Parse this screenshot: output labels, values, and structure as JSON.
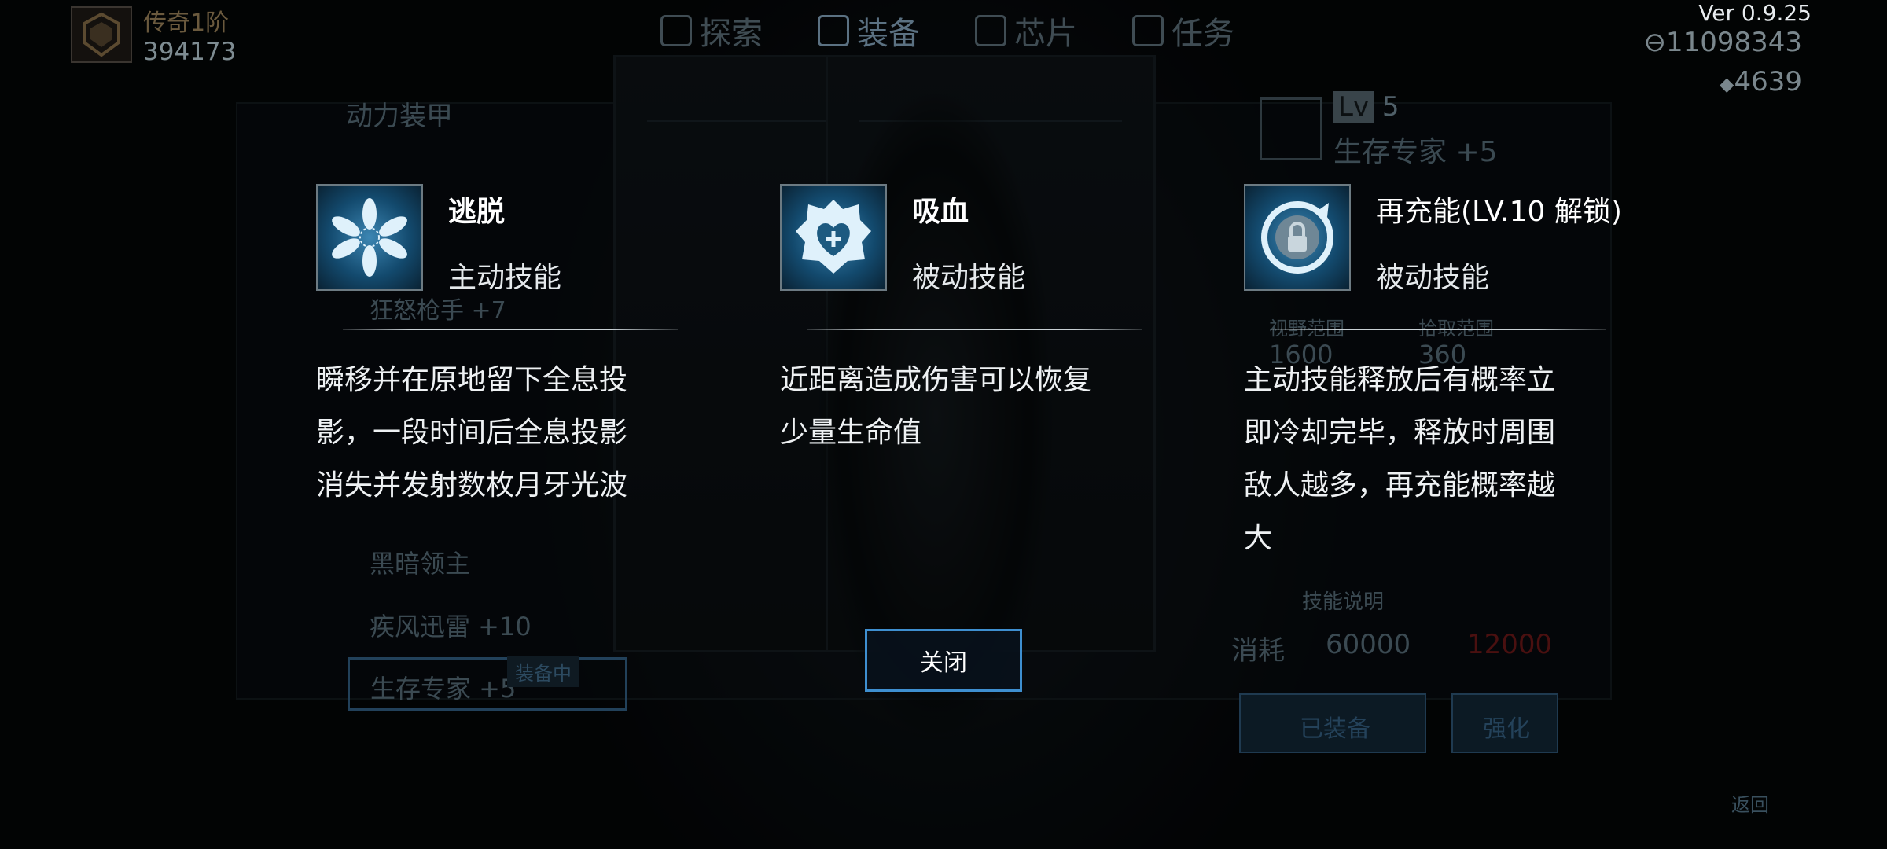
{
  "version": "Ver 0.9.25",
  "rank": {
    "title": "传奇1阶",
    "score": "394173"
  },
  "tabs": [
    {
      "label": "探索",
      "active": false
    },
    {
      "label": "装备",
      "active": true
    },
    {
      "label": "芯片",
      "active": false
    },
    {
      "label": "任务",
      "active": false
    }
  ],
  "currency": {
    "coins": "11098343",
    "gems": "4639"
  },
  "background": {
    "category": "动力装甲",
    "armor_list": [
      "黑暗领主",
      "疾风迅雷 +10",
      "生存专家 +5"
    ],
    "equipped_badge": "装备中",
    "left_items": [
      "狂怒枪手 +7"
    ],
    "level_prefix": "Lv",
    "level": "5",
    "armor_name": "生存专家 +5",
    "stats": [
      {
        "label": "视野范围",
        "value": "1600"
      },
      {
        "label": "拾取范围",
        "value": "360"
      }
    ],
    "skill_desc_label": "技能说明",
    "cost_label": "消耗",
    "cost_coins": "60000",
    "cost_gems": "12000",
    "equipped_btn": "已装备",
    "upgrade_btn": "强化",
    "back": "返回"
  },
  "skills": [
    {
      "name": "逃脱",
      "type": "主动技能",
      "icon": "flower-burst-icon",
      "description": "瞬移并在原地留下全息投影，一段时间后全息投影消失并发射数枚月牙光波"
    },
    {
      "name": "吸血",
      "type": "被动技能",
      "icon": "heart-shield-icon",
      "description": "近距离造成伤害可以恢复少量生命值"
    },
    {
      "name": "再充能(LV.10 解锁)",
      "type": "被动技能",
      "icon": "recharge-lock-icon",
      "description": "主动技能释放后有概率立即冷却完毕，释放时周围敌人越多，再充能概率越大"
    }
  ],
  "close_label": "关闭",
  "colors": {
    "accent": "#3e8fd0",
    "cost_red": "#8a1c1c"
  }
}
